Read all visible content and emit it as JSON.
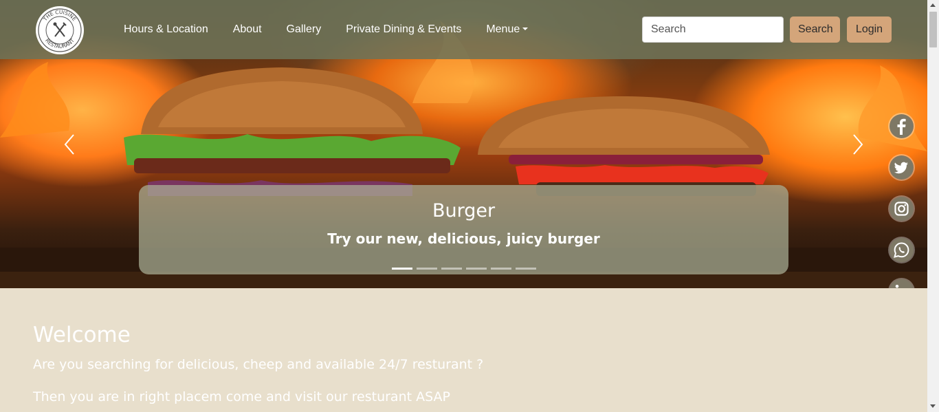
{
  "logo": {
    "text_top": "THE CUISINE",
    "text_bottom": "RESTAURANT"
  },
  "nav": {
    "links": [
      {
        "label": "Hours & Location"
      },
      {
        "label": "About"
      },
      {
        "label": "Gallery"
      },
      {
        "label": "Private Dining & Events"
      },
      {
        "label": "Menue"
      }
    ]
  },
  "search": {
    "placeholder": "Search",
    "value": "",
    "button_label": "Search"
  },
  "login": {
    "label": "Login"
  },
  "carousel": {
    "caption_title": "Burger",
    "caption_text": "Try our new, delicious, juicy burger",
    "slide_count": 6,
    "active_index": 0
  },
  "social": [
    {
      "icon": "facebook-icon"
    },
    {
      "icon": "twitter-icon"
    },
    {
      "icon": "instagram-icon"
    },
    {
      "icon": "whatsapp-icon"
    },
    {
      "icon": "linkedin-icon"
    }
  ],
  "welcome": {
    "title": "Welcome",
    "line1": "Are you searching for delicious, cheep and available 24/7 resturant ?",
    "line2": "Then you are in right placem come and visit our resturant ASAP"
  },
  "colors": {
    "navbar": "#6e7358",
    "button": "#d4a57a",
    "page_background": "#e8dfcc",
    "social_icon": "#7e7865"
  }
}
